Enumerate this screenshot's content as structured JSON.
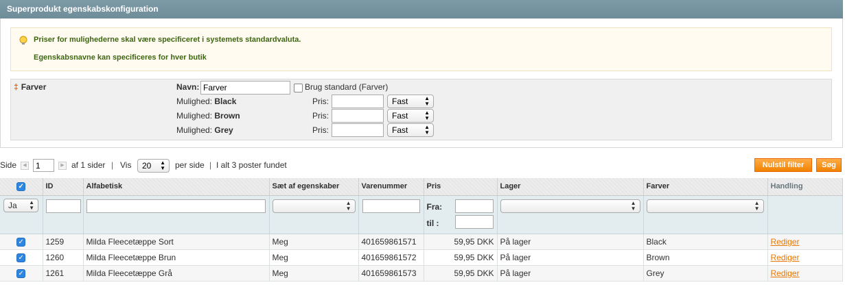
{
  "section": {
    "title": "Superprodukt egenskabskonfiguration"
  },
  "notice": {
    "line1": "Priser for mulighederne skal være specificeret i systemets standardvaluta.",
    "line2": "Egenskabsnavne kan specificeres for hver butik"
  },
  "attribute": {
    "title": "Farver",
    "name_label": "Navn:",
    "name_value": "Farver",
    "use_default_label": "Brug standard (Farver)",
    "option_label": "Mulighed:",
    "price_label": "Pris:",
    "options": [
      {
        "name": "Black",
        "price": "",
        "type": "Fast"
      },
      {
        "name": "Brown",
        "price": "",
        "type": "Fast"
      },
      {
        "name": "Grey",
        "price": "",
        "type": "Fast"
      }
    ]
  },
  "pager": {
    "page_label": "Side",
    "page_value": "1",
    "of_pages": "af 1 sider",
    "view_label": "Vis",
    "per_page": "20",
    "per_page_suffix": "per side",
    "total": "I alt 3 poster fundet",
    "sep": "|"
  },
  "buttons": {
    "reset_filter": "Nulstil filter",
    "search": "Søg"
  },
  "grid": {
    "columns": [
      "ID",
      "Alfabetisk",
      "Sæt af egenskaber",
      "Varenummer",
      "Pris",
      "Lager",
      "Farver",
      "Handling"
    ],
    "filter": {
      "in_products": "Ja",
      "price_from": "Fra:",
      "price_to": "til :"
    },
    "rows": [
      {
        "id": "1259",
        "name": "Milda Fleecetæppe Sort",
        "set": "Meg",
        "sku": "401659861571",
        "price": "59,95 DKK",
        "stock": "På lager",
        "color": "Black",
        "action": "Rediger"
      },
      {
        "id": "1260",
        "name": "Milda Fleecetæppe Brun",
        "set": "Meg",
        "sku": "401659861572",
        "price": "59,95 DKK",
        "stock": "På lager",
        "color": "Brown",
        "action": "Rediger"
      },
      {
        "id": "1261",
        "name": "Milda Fleecetæppe Grå",
        "set": "Meg",
        "sku": "401659861573",
        "price": "59,95 DKK",
        "stock": "På lager",
        "color": "Grey",
        "action": "Rediger"
      }
    ]
  },
  "colors": {
    "header": "#6f8c99",
    "accent": "#f18200",
    "link": "#ea7601",
    "check": "#2f86e0"
  }
}
